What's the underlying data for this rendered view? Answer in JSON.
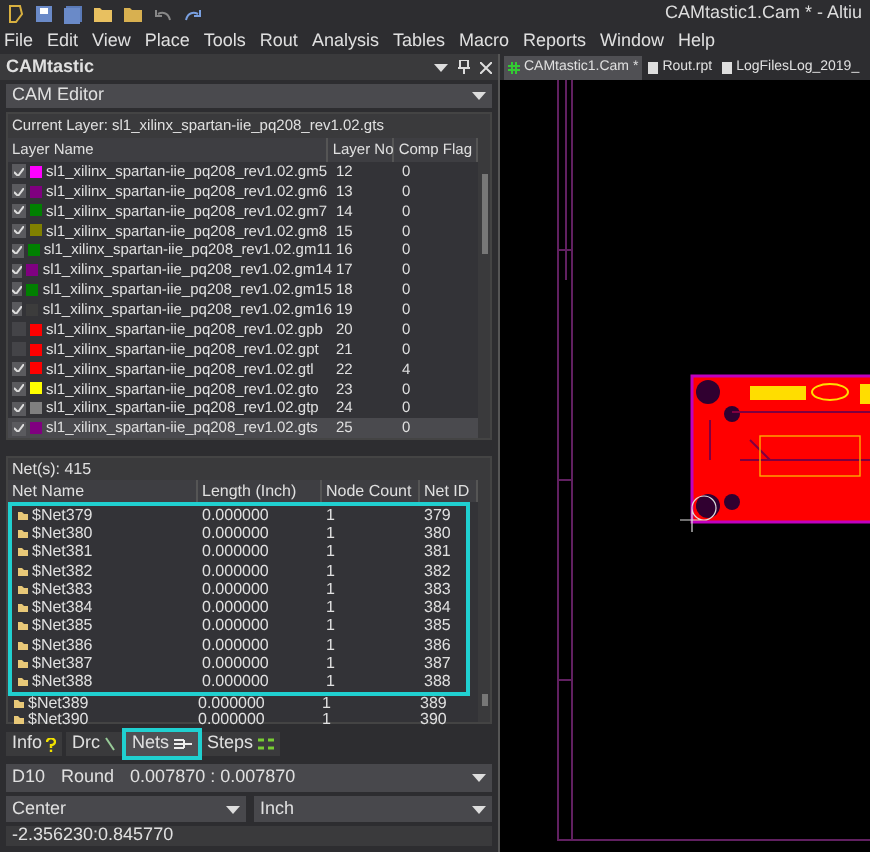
{
  "window": {
    "title": "CAMtastic1.Cam * - Altiu"
  },
  "menu": [
    "File",
    "Edit",
    "View",
    "Place",
    "Tools",
    "Rout",
    "Analysis",
    "Tables",
    "Macro",
    "Reports",
    "Window",
    "Help"
  ],
  "panel": {
    "title": "CAMtastic",
    "mode": "CAM Editor",
    "current_layer": "Current Layer: sl1_xilinx_spartan-iie_pq208_rev1.02.gts"
  },
  "layer_table": {
    "columns": [
      "Layer Name",
      "Layer No",
      "Comp Flag"
    ],
    "rows": [
      {
        "name": "sl1_xilinx_spartan-iie_pq208_rev1.02.gm5",
        "layer_no": "12",
        "comp_flag": "0",
        "checked": true,
        "color": "#ff00ff",
        "selected": false
      },
      {
        "name": "sl1_xilinx_spartan-iie_pq208_rev1.02.gm6",
        "layer_no": "13",
        "comp_flag": "0",
        "checked": true,
        "color": "#800080",
        "selected": false
      },
      {
        "name": "sl1_xilinx_spartan-iie_pq208_rev1.02.gm7",
        "layer_no": "14",
        "comp_flag": "0",
        "checked": true,
        "color": "#008000",
        "selected": false
      },
      {
        "name": "sl1_xilinx_spartan-iie_pq208_rev1.02.gm8",
        "layer_no": "15",
        "comp_flag": "0",
        "checked": true,
        "color": "#808000",
        "selected": false
      },
      {
        "name": "sl1_xilinx_spartan-iie_pq208_rev1.02.gm11",
        "layer_no": "16",
        "comp_flag": "0",
        "checked": true,
        "color": "#008000",
        "selected": false
      },
      {
        "name": "sl1_xilinx_spartan-iie_pq208_rev1.02.gm14",
        "layer_no": "17",
        "comp_flag": "0",
        "checked": true,
        "color": "#800080",
        "selected": false
      },
      {
        "name": "sl1_xilinx_spartan-iie_pq208_rev1.02.gm15",
        "layer_no": "18",
        "comp_flag": "0",
        "checked": true,
        "color": "#008000",
        "selected": false
      },
      {
        "name": "sl1_xilinx_spartan-iie_pq208_rev1.02.gm16",
        "layer_no": "19",
        "comp_flag": "0",
        "checked": true,
        "color": "#3c3c3c",
        "selected": false
      },
      {
        "name": "sl1_xilinx_spartan-iie_pq208_rev1.02.gpb",
        "layer_no": "20",
        "comp_flag": "0",
        "checked": false,
        "color": "#ff0000",
        "selected": false
      },
      {
        "name": "sl1_xilinx_spartan-iie_pq208_rev1.02.gpt",
        "layer_no": "21",
        "comp_flag": "0",
        "checked": false,
        "color": "#ff0000",
        "selected": false
      },
      {
        "name": "sl1_xilinx_spartan-iie_pq208_rev1.02.gtl",
        "layer_no": "22",
        "comp_flag": "4",
        "checked": true,
        "color": "#ff0000",
        "selected": false
      },
      {
        "name": "sl1_xilinx_spartan-iie_pq208_rev1.02.gto",
        "layer_no": "23",
        "comp_flag": "0",
        "checked": true,
        "color": "#ffff00",
        "selected": false
      },
      {
        "name": "sl1_xilinx_spartan-iie_pq208_rev1.02.gtp",
        "layer_no": "24",
        "comp_flag": "0",
        "checked": true,
        "color": "#808080",
        "selected": false
      },
      {
        "name": "sl1_xilinx_spartan-iie_pq208_rev1.02.gts",
        "layer_no": "25",
        "comp_flag": "0",
        "checked": true,
        "color": "#800080",
        "selected": true
      }
    ]
  },
  "nets": {
    "count": "Net(s): 415",
    "columns": [
      "Net Name",
      "Length (Inch)",
      "Node Count",
      "Net ID"
    ],
    "rows": [
      {
        "name": "$Net379",
        "length": "0.000000",
        "nodes": "1",
        "id": "379"
      },
      {
        "name": "$Net380",
        "length": "0.000000",
        "nodes": "1",
        "id": "380"
      },
      {
        "name": "$Net381",
        "length": "0.000000",
        "nodes": "1",
        "id": "381"
      },
      {
        "name": "$Net382",
        "length": "0.000000",
        "nodes": "1",
        "id": "382"
      },
      {
        "name": "$Net383",
        "length": "0.000000",
        "nodes": "1",
        "id": "383"
      },
      {
        "name": "$Net384",
        "length": "0.000000",
        "nodes": "1",
        "id": "384"
      },
      {
        "name": "$Net385",
        "length": "0.000000",
        "nodes": "1",
        "id": "385"
      },
      {
        "name": "$Net386",
        "length": "0.000000",
        "nodes": "1",
        "id": "386"
      },
      {
        "name": "$Net387",
        "length": "0.000000",
        "nodes": "1",
        "id": "387"
      },
      {
        "name": "$Net388",
        "length": "0.000000",
        "nodes": "1",
        "id": "388"
      },
      {
        "name": "$Net389",
        "length": "0.000000",
        "nodes": "1",
        "id": "389"
      },
      {
        "name": "$Net390",
        "length": "0.000000",
        "nodes": "1",
        "id": "390"
      }
    ]
  },
  "panel_tabs": [
    {
      "label": "Info",
      "kind": "info",
      "selected": false
    },
    {
      "label": "Drc",
      "kind": "drc",
      "selected": false
    },
    {
      "label": "Nets",
      "kind": "nets",
      "selected": true
    },
    {
      "label": "Steps",
      "kind": "steps",
      "selected": false
    }
  ],
  "aperture": {
    "code": "D10",
    "shape": "Round",
    "size": "0.007870 : 0.007870"
  },
  "origin": "Center",
  "units": "Inch",
  "coordinates": "-2.356230:0.845770",
  "doc_tabs": [
    {
      "label": "CAMtastic1.Cam *",
      "kind": "cam",
      "selected": true
    },
    {
      "label": "Rout.rpt",
      "kind": "doc",
      "selected": false
    },
    {
      "label": "LogFilesLog_2019_",
      "kind": "doc",
      "selected": false
    }
  ]
}
